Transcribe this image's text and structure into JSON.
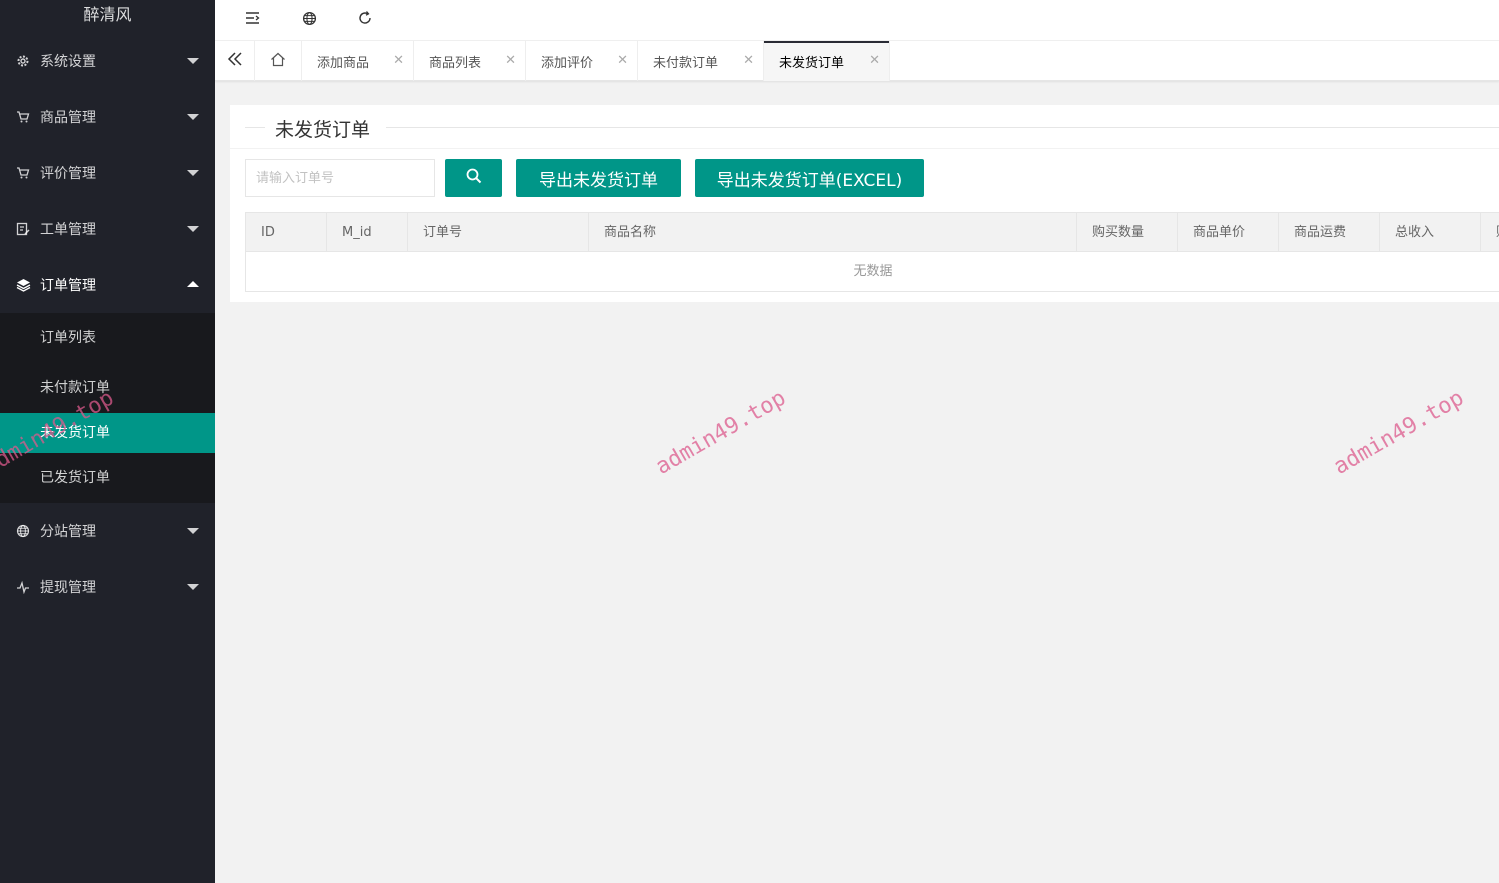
{
  "app": {
    "logo": "醉清风"
  },
  "sidebar": {
    "items": [
      {
        "label": "系统设置",
        "icon": "gear-icon"
      },
      {
        "label": "商品管理",
        "icon": "cart-icon"
      },
      {
        "label": "评价管理",
        "icon": "cart-icon"
      },
      {
        "label": "工单管理",
        "icon": "ticket-icon"
      },
      {
        "label": "订单管理",
        "icon": "layers-icon",
        "open": true
      },
      {
        "label": "分站管理",
        "icon": "globe-icon"
      },
      {
        "label": "提现管理",
        "icon": "pulse-icon"
      }
    ],
    "order_submenu": [
      {
        "label": "订单列表"
      },
      {
        "label": "未付款订单"
      },
      {
        "label": "未发货订单",
        "active": true
      },
      {
        "label": "已发货订单"
      }
    ]
  },
  "topbar": {
    "icons": [
      "menu-fold-icon",
      "globe-icon",
      "refresh-icon"
    ]
  },
  "tabs": [
    {
      "label": "添加商品"
    },
    {
      "label": "商品列表"
    },
    {
      "label": "添加评价"
    },
    {
      "label": "未付款订单"
    },
    {
      "label": "未发货订单",
      "active": true
    }
  ],
  "page": {
    "title": "未发货订单",
    "search_placeholder": "请输入订单号",
    "export_button": "导出未发货订单",
    "export_excel_button": "导出未发货订单(EXCEL)"
  },
  "table": {
    "columns": [
      "ID",
      "M_id",
      "订单号",
      "商品名称",
      "购买数量",
      "商品单价",
      "商品运费",
      "总收入",
      "财"
    ],
    "empty_text": "无数据"
  },
  "watermark": "admin49.top",
  "colors": {
    "accent": "#009688",
    "sidebar_bg": "#20222a",
    "submenu_bg": "#18191d"
  }
}
